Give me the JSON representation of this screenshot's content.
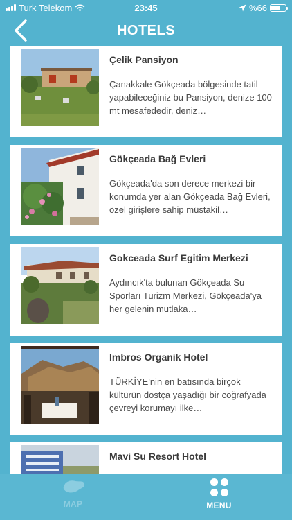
{
  "status": {
    "carrier": "Turk Telekom",
    "time": "23:45",
    "battery_percent": "%66",
    "battery_level": 0.66,
    "icons": [
      "signal-icon",
      "wifi-icon",
      "location-arrow-icon",
      "battery-icon"
    ]
  },
  "nav": {
    "title": "HOTELS",
    "back_icon": "chevron-left-icon"
  },
  "hotels": [
    {
      "name": "Çelik Pansiyon",
      "description": "Çanakkale Gökçeada bölgesinde tatil yapabileceğiniz bu Pansiyon, denize 100 mt mesafededir, deniz…"
    },
    {
      "name": "Gökçeada Bağ Evleri",
      "description": "Gökçeada'da son derece merkezi bir konumda yer alan Gökçeada Bağ Evleri, özel girişlere sahip müstakil…"
    },
    {
      "name": "Gokceada Surf Egitim Merkezi",
      "description": "Aydıncık'ta bulunan Gökçeada Su Sporları Turizm Merkezi, Gökçeada'ya  her gelenin mutlaka…"
    },
    {
      "name": "Imbros Organik Hotel",
      "description": "TÜRKİYE'nin en batısında birçok kültürün dostça yaşadığı bir coğrafyada çevreyi korumayı ilke…"
    },
    {
      "name": "Mavi Su Resort Hotel",
      "description": ""
    }
  ],
  "tabs": {
    "map_label": "MAP",
    "menu_label": "MENU",
    "map_icon": "map-icon",
    "menu_icon": "grid-dots-icon"
  },
  "colors": {
    "primary": "#53b3cf",
    "card_bg": "#ffffff",
    "title_text": "#3a3a3a"
  }
}
